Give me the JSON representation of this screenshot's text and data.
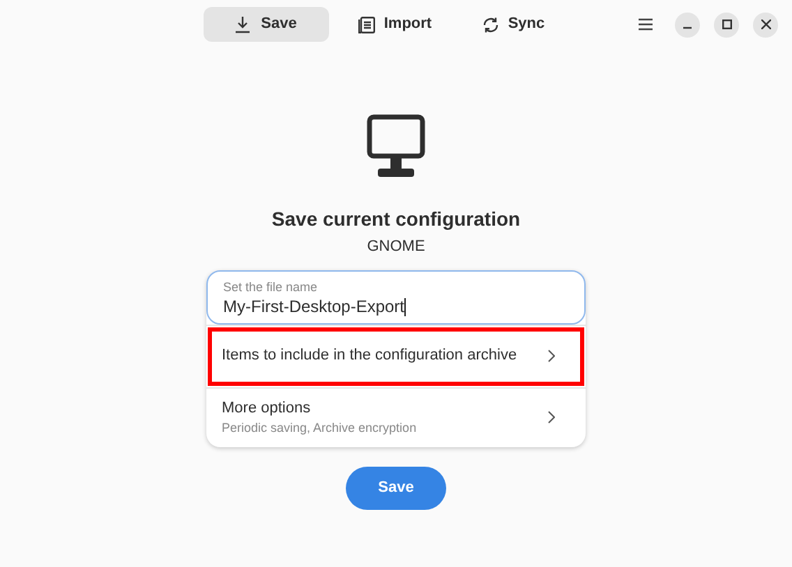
{
  "tabs": [
    {
      "label": "Save",
      "selected": true
    },
    {
      "label": "Import",
      "selected": false
    },
    {
      "label": "Sync",
      "selected": false
    }
  ],
  "title": "Save current configuration",
  "subtitle": "GNOME",
  "file_name": {
    "label": "Set the file name",
    "value": "My-First-Desktop-Export"
  },
  "rows": [
    {
      "title": "Items to include in the configuration archive",
      "highlighted": true
    },
    {
      "title": "More options",
      "subtitle": "Periodic saving, Archive encryption",
      "highlighted": false
    }
  ],
  "button": "Save"
}
